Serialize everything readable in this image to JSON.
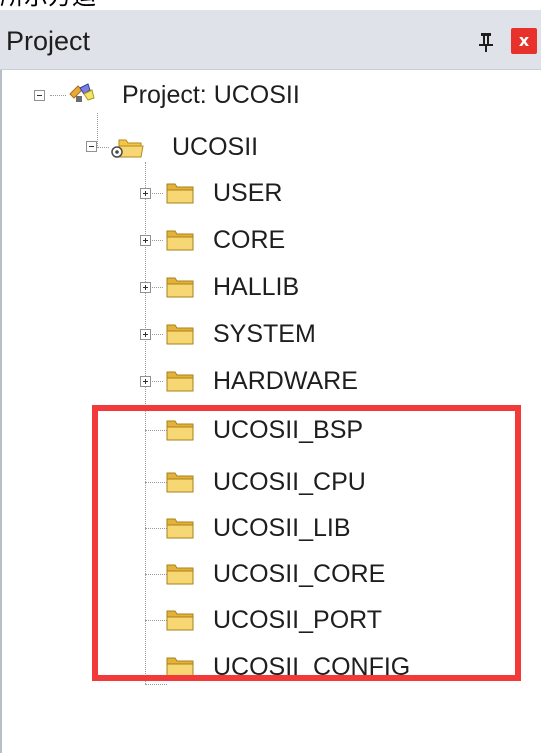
{
  "top_text": "所示方运",
  "panel": {
    "title": "Project",
    "pin_icon": "pushpin-icon",
    "close_label": "x",
    "close_icon": "close-icon"
  },
  "tree": {
    "root": {
      "label": "Project: UCOSII",
      "icon": "project-icon",
      "expanded": true
    },
    "target": {
      "label": "UCOSII",
      "icon": "target-folder-icon",
      "expanded": true
    },
    "groups": [
      {
        "label": "USER",
        "icon": "folder-icon",
        "expandable": true
      },
      {
        "label": "CORE",
        "icon": "folder-icon",
        "expandable": true
      },
      {
        "label": "HALLIB",
        "icon": "folder-icon",
        "expandable": true
      },
      {
        "label": "SYSTEM",
        "icon": "folder-icon",
        "expandable": true
      },
      {
        "label": "HARDWARE",
        "icon": "folder-icon",
        "expandable": true
      },
      {
        "label": "UCOSII_BSP",
        "icon": "folder-icon",
        "expandable": false
      },
      {
        "label": "UCOSII_CPU",
        "icon": "folder-icon",
        "expandable": false
      },
      {
        "label": "UCOSII_LIB",
        "icon": "folder-icon",
        "expandable": false
      },
      {
        "label": "UCOSII_CORE",
        "icon": "folder-icon",
        "expandable": false
      },
      {
        "label": "UCOSII_PORT",
        "icon": "folder-icon",
        "expandable": false
      },
      {
        "label": "UCOSII_CONFIG",
        "icon": "folder-icon",
        "expandable": false
      }
    ]
  },
  "colors": {
    "header_bg": "#dfe3e9",
    "highlight": "#f23a3a",
    "folder": "#f2c649",
    "close": "#e8312b"
  }
}
